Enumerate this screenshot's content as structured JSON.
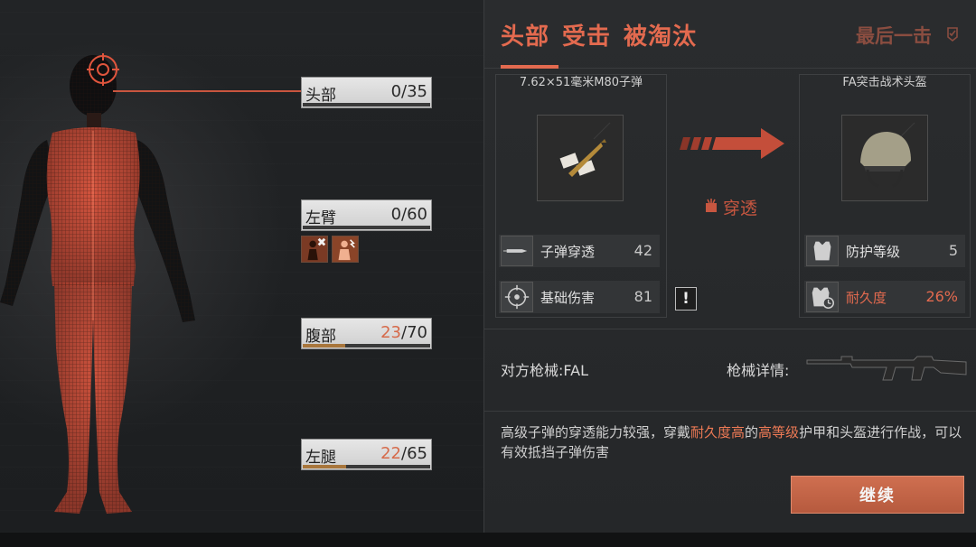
{
  "body_parts": [
    {
      "name": "头部",
      "current": "0",
      "max": "35",
      "fill": 0.0,
      "hurt": false
    },
    {
      "name": "左臂",
      "current": "0",
      "max": "60",
      "fill": 0.0,
      "hurt": false
    },
    {
      "name": "腹部",
      "current": "23",
      "max": "70",
      "fill": 0.33,
      "hurt": true
    },
    {
      "name": "左腿",
      "current": "22",
      "max": "65",
      "fill": 0.34,
      "hurt": true
    }
  ],
  "status_icons": [
    "fracture-status-icon",
    "pain-status-icon"
  ],
  "header": {
    "parts": [
      "头部",
      "受击",
      "被淘汰"
    ],
    "last_hit": "最后一击",
    "accent": "#e36a4f"
  },
  "ammo": {
    "title": "7.62×51毫米M80子弹",
    "stats": [
      {
        "label": "子弹穿透",
        "value": "42",
        "icon": "bullet-penetration-icon"
      },
      {
        "label": "基础伤害",
        "value": "81",
        "icon": "crosshair-icon"
      }
    ]
  },
  "penetration": {
    "label": "穿透",
    "icon": "penetrate-icon",
    "warn": "!"
  },
  "armor": {
    "title": "FA突击战术头盔",
    "stats": [
      {
        "label": "防护等级",
        "value": "5",
        "icon": "armor-vest-icon"
      },
      {
        "label": "耐久度",
        "value": "26%",
        "icon": "durability-icon"
      }
    ]
  },
  "weapon": {
    "enemy": "对方枪械:FAL",
    "detail": "枪械详情:"
  },
  "tip": {
    "part1": "高级子弹的穿透能力较强，穿戴",
    "hl1": "耐久度高",
    "part2": "的",
    "hl2": "高等级",
    "part3": "护甲和头盔进行作战，可以有效抵挡子弹伤害"
  },
  "continue_label": "继续"
}
